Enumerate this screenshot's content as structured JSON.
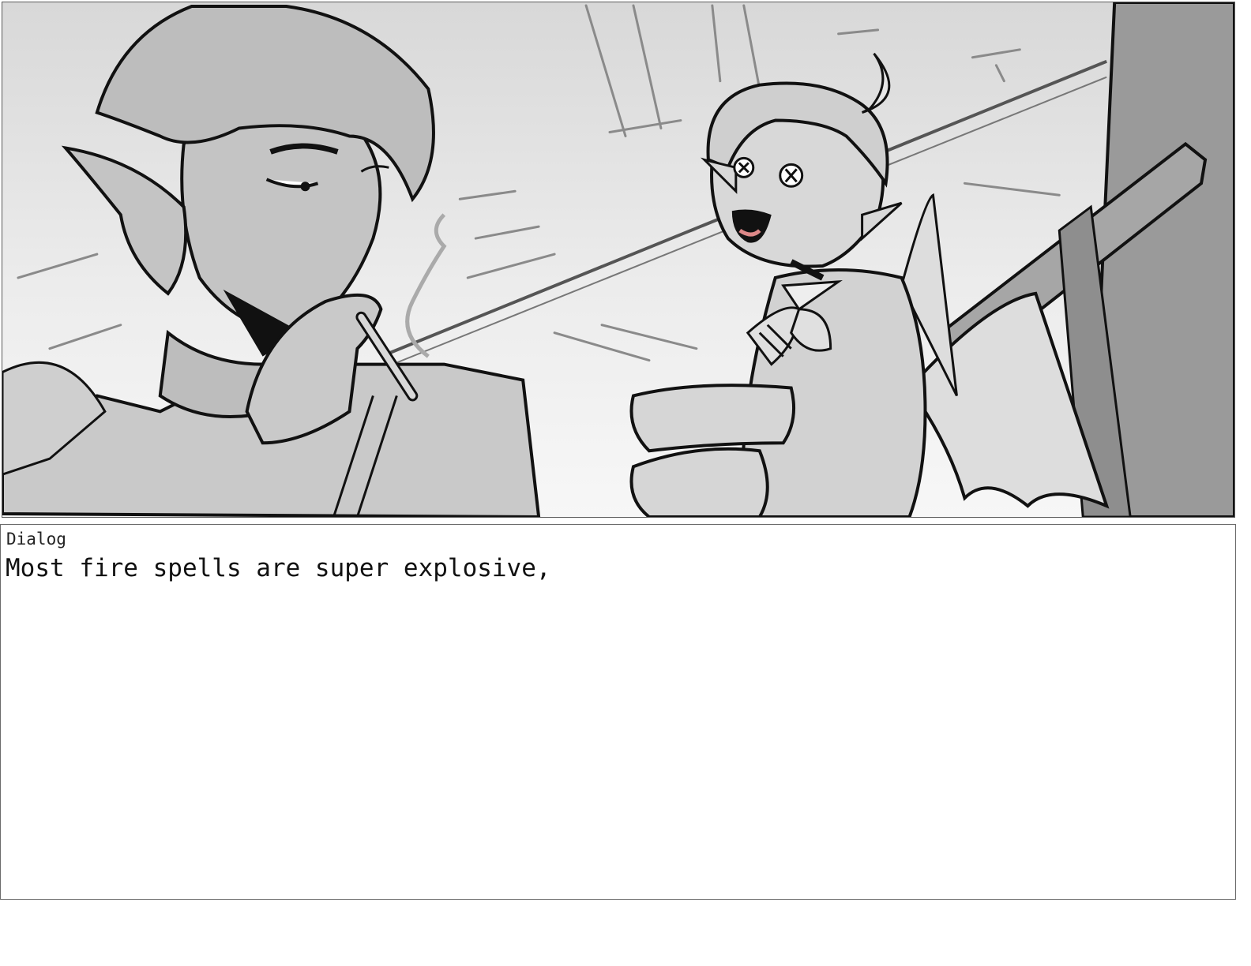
{
  "storyboard": {
    "panel": {
      "image_description_icon": "storyboard-sketch-icon"
    },
    "dialog": {
      "label": "Dialog",
      "text": "Most fire spells are super explosive,"
    }
  }
}
